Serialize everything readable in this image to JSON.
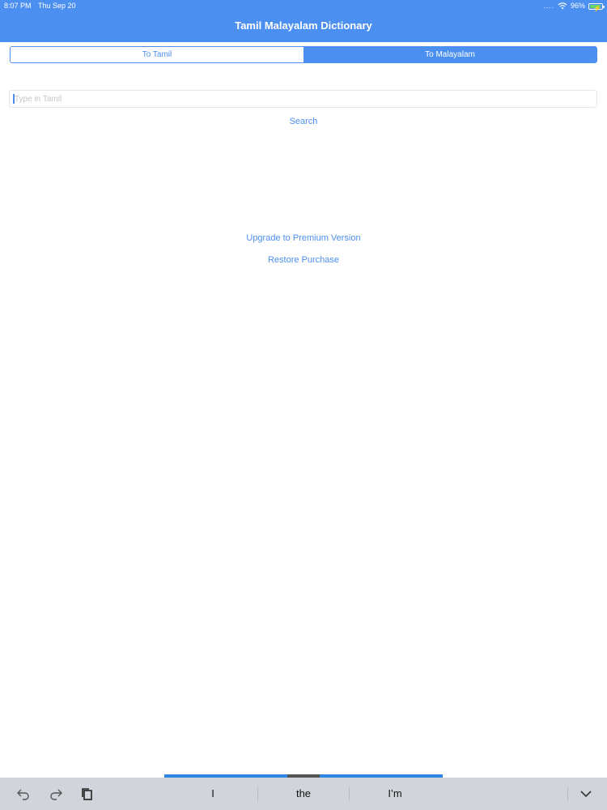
{
  "status_bar": {
    "time": "8:07 PM",
    "date": "Thu Sep 20",
    "signal_dots": "....",
    "battery_percent": "96%",
    "battery_level": 0.96,
    "icons": [
      "wifi-icon",
      "battery-icon",
      "charging-bolt-icon"
    ]
  },
  "nav": {
    "title": "Tamil Malayalam Dictionary"
  },
  "segmented": {
    "options": [
      "To Tamil",
      "To Malayalam"
    ],
    "selected": "To Malayalam"
  },
  "search": {
    "placeholder": "Type in Tamil",
    "value": "",
    "button_label": "Search"
  },
  "purchase": {
    "upgrade_label": "Upgrade to Premium Version",
    "restore_label": "Restore Purchase"
  },
  "keyboard_bar": {
    "suggestions": [
      "I",
      "the",
      "I’m"
    ],
    "icons": [
      "undo-icon",
      "redo-icon",
      "paste-icon",
      "dismiss-keyboard-icon"
    ]
  },
  "colors": {
    "accent": "#4b8ff0",
    "keyboard_bg": "#d1d4da"
  }
}
